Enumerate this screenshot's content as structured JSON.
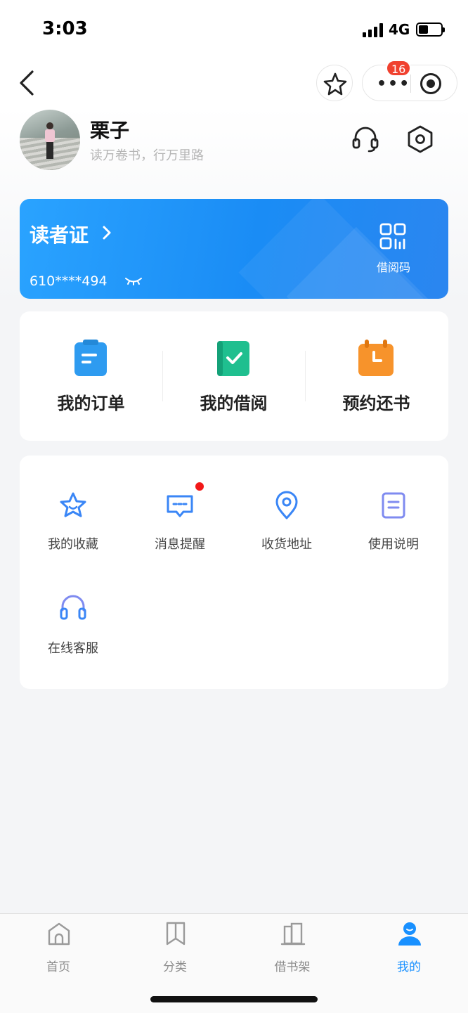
{
  "status_bar": {
    "time": "3:03",
    "network": "4G"
  },
  "nav": {
    "badge_count": "16"
  },
  "profile": {
    "name": "栗子",
    "motto": "读万卷书，行万里路"
  },
  "reader_card": {
    "title": "读者证",
    "number": "610****494",
    "qr_label": "借阅码"
  },
  "quick_actions": [
    {
      "label": "我的订单",
      "icon": "order-clipboard-icon"
    },
    {
      "label": "我的借阅",
      "icon": "borrow-check-book-icon"
    },
    {
      "label": "预约还书",
      "icon": "reserve-calendar-icon"
    }
  ],
  "services": [
    {
      "label": "我的收藏",
      "icon": "star-icon"
    },
    {
      "label": "消息提醒",
      "icon": "message-icon",
      "unread_dot": true
    },
    {
      "label": "收货地址",
      "icon": "location-pin-icon"
    },
    {
      "label": "使用说明",
      "icon": "document-icon"
    },
    {
      "label": "在线客服",
      "icon": "headphones-icon"
    }
  ],
  "tabs": [
    {
      "label": "首页",
      "icon": "home-icon",
      "active": false
    },
    {
      "label": "分类",
      "icon": "bookmark-icon",
      "active": false
    },
    {
      "label": "借书架",
      "icon": "bookshelf-icon",
      "active": false
    },
    {
      "label": "我的",
      "icon": "person-icon",
      "active": true
    }
  ],
  "colors": {
    "accent": "#1890ff",
    "card_blue": "#1a8cf5",
    "badge_red": "#f0412f",
    "order_blue": "#2e9bf0",
    "borrow_green": "#1fbf8f",
    "reserve_orange": "#f7932b",
    "service_icon_blue": "#3a86f6",
    "service_icon_purple": "#7f8bf0"
  }
}
